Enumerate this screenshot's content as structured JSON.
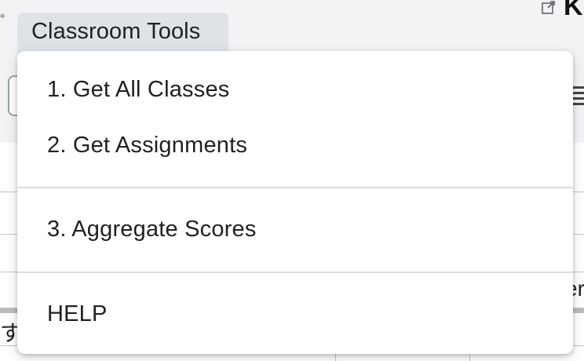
{
  "menu_bar": {
    "active_menu": "Classroom Tools",
    "left_glyph": "°",
    "right_glyph": "K"
  },
  "background": {
    "cell_text_left": "す。",
    "cell_text_right": "er"
  },
  "dropdown": {
    "items": [
      {
        "label": "1. Get All Classes"
      },
      {
        "label": "2. Get Assignments"
      },
      {
        "label": "3. Aggregate Scores"
      },
      {
        "label": "HELP"
      }
    ]
  },
  "icons": {
    "edit": "open-in-new-icon",
    "format": "format-lines-icon"
  }
}
